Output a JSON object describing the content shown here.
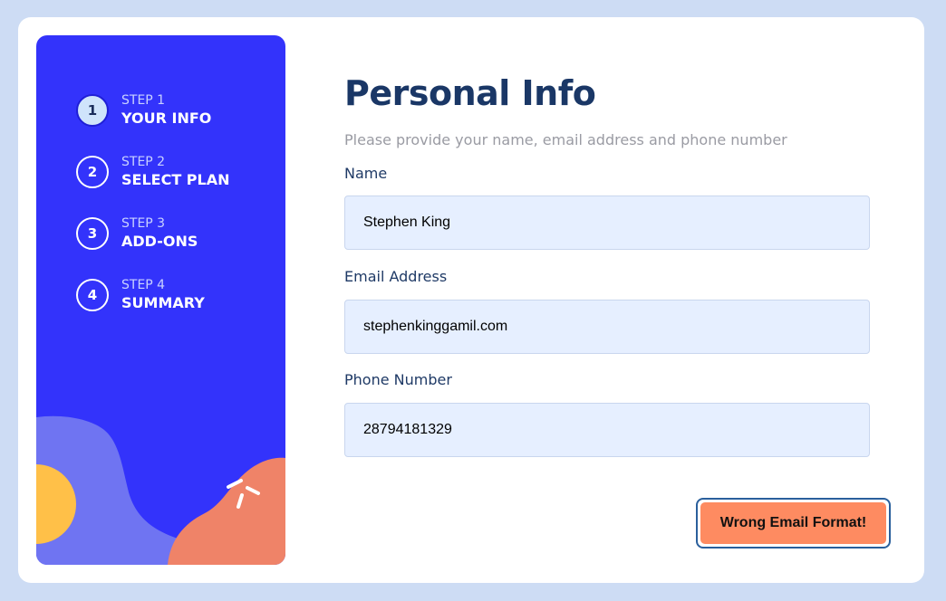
{
  "colors": {
    "page_background": "#cddcf4",
    "sidebar": "#3333fb",
    "title": "#1a3766",
    "input_background": "#e6efff",
    "error_button": "#fe8b61"
  },
  "sidebar": {
    "steps": [
      {
        "number": "1",
        "label": "STEP 1",
        "title": "YOUR INFO",
        "active": true
      },
      {
        "number": "2",
        "label": "STEP 2",
        "title": "SELECT PLAN",
        "active": false
      },
      {
        "number": "3",
        "label": "STEP 3",
        "title": "ADD-ONS",
        "active": false
      },
      {
        "number": "4",
        "label": "STEP 4",
        "title": "SUMMARY",
        "active": false
      }
    ]
  },
  "main": {
    "title": "Personal Info",
    "subtitle": "Please provide your name, email address and phone number",
    "fields": {
      "name": {
        "label": "Name",
        "value": "Stephen King"
      },
      "email": {
        "label": "Email Address",
        "value": "stephenkinggamil.com"
      },
      "phone": {
        "label": "Phone Number",
        "value": "28794181329"
      }
    },
    "error_button_label": "Wrong Email Format!"
  }
}
